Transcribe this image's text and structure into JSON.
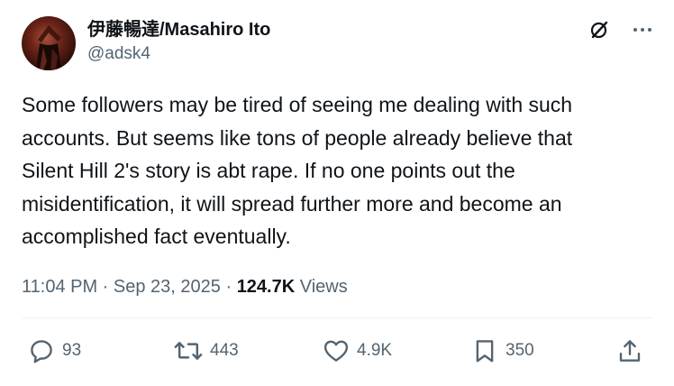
{
  "author": {
    "display_name": "伊藤暢達/Masahiro Ito",
    "handle": "@adsk4"
  },
  "tweet": {
    "text": "Some followers may be tired of seeing me dealing with such\naccounts. But seems like tons of people already believe that\nSilent Hill 2's story is abt rape. If no one points out the\nmisidentification, it will spread further more and become an\naccomplished fact eventually."
  },
  "meta": {
    "time": "11:04 PM",
    "separator": " · ",
    "date": "Sep 23, 2025",
    "views_count": "124.7K",
    "views_label": "Views"
  },
  "actions": {
    "replies": "93",
    "reposts": "443",
    "likes": "4.9K",
    "bookmarks": "350"
  },
  "icons": {
    "grok": "grok-icon",
    "more": "more-icon",
    "reply": "reply-icon",
    "repost": "repost-icon",
    "like": "heart-icon",
    "bookmark": "bookmark-icon",
    "share": "share-icon"
  },
  "colors": {
    "text": "#0f1419",
    "secondary": "#536471"
  }
}
